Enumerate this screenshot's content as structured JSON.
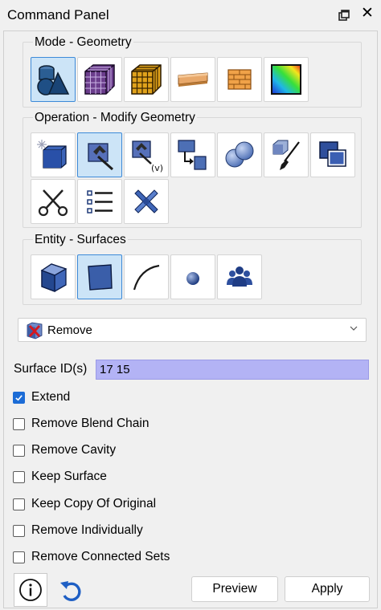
{
  "window": {
    "title": "Command Panel",
    "float_icon": "float-window-icon",
    "close_icon": "close-icon",
    "close_glyph": "✕"
  },
  "mode_group": {
    "title": "Mode - Geometry",
    "tools": [
      {
        "name": "geometry-mode",
        "icon": "geometry-primitives-icon",
        "selected": true
      },
      {
        "name": "mesh-mode",
        "icon": "mesh-cube-icon",
        "selected": false
      },
      {
        "name": "hex-mesh-mode",
        "icon": "hex-mesh-cube-icon",
        "selected": false
      },
      {
        "name": "boundary-condition-mode",
        "icon": "bc-plank-icon",
        "selected": false
      },
      {
        "name": "material-mode",
        "icon": "brick-block-icon",
        "selected": false
      },
      {
        "name": "analysis-mode",
        "icon": "contour-plot-icon",
        "selected": false
      }
    ]
  },
  "operation_group": {
    "title": "Operation - Modify Geometry",
    "tools": [
      {
        "name": "create-geometry",
        "icon": "new-cube-icon",
        "selected": false
      },
      {
        "name": "modify-geometry",
        "icon": "hammer-icon",
        "selected": true
      },
      {
        "name": "modify-virtual",
        "icon": "hammer-virtual-icon",
        "selected": false
      },
      {
        "name": "transform",
        "icon": "transform-arrow-icon",
        "selected": false
      },
      {
        "name": "boolean",
        "icon": "boolean-spheres-icon",
        "selected": false
      },
      {
        "name": "paint",
        "icon": "brush-icon",
        "selected": false
      },
      {
        "name": "copy",
        "icon": "copy-squares-icon",
        "selected": false
      },
      {
        "name": "cut",
        "icon": "scissors-icon",
        "selected": false
      },
      {
        "name": "list",
        "icon": "list-icon",
        "selected": false
      },
      {
        "name": "repair",
        "icon": "tools-cross-icon",
        "selected": false
      }
    ]
  },
  "entity_group": {
    "title": "Entity - Surfaces",
    "tools": [
      {
        "name": "volume-entity",
        "icon": "volume-cube-icon",
        "selected": false
      },
      {
        "name": "surface-entity",
        "icon": "surface-square-icon",
        "selected": true
      },
      {
        "name": "curve-entity",
        "icon": "curve-icon",
        "selected": false
      },
      {
        "name": "vertex-entity",
        "icon": "vertex-sphere-icon",
        "selected": false
      },
      {
        "name": "group-entity",
        "icon": "group-people-icon",
        "selected": false
      }
    ]
  },
  "action_dropdown": {
    "value": "Remove",
    "icon": "remove-surface-icon",
    "arrow_icon": "chevron-down-icon"
  },
  "surface_ids": {
    "label": "Surface ID(s)",
    "value": "17 15"
  },
  "options": [
    {
      "label": "Extend",
      "checked": true
    },
    {
      "label": "Remove Blend Chain",
      "checked": false
    },
    {
      "label": "Remove Cavity",
      "checked": false
    },
    {
      "label": "Keep Surface",
      "checked": false
    },
    {
      "label": "Keep Copy Of Original",
      "checked": false
    },
    {
      "label": "Remove Individually",
      "checked": false
    },
    {
      "label": "Remove Connected Sets",
      "checked": false
    }
  ],
  "footer": {
    "info_icon": "info-icon",
    "reset_icon": "reset-icon",
    "preview_label": "Preview",
    "apply_label": "Apply"
  },
  "colors": {
    "selection": "#cce4f7",
    "selection_border": "#3d8ad8",
    "input_highlight": "#b3b3f5",
    "checkbox_blue": "#1c6cd6"
  }
}
